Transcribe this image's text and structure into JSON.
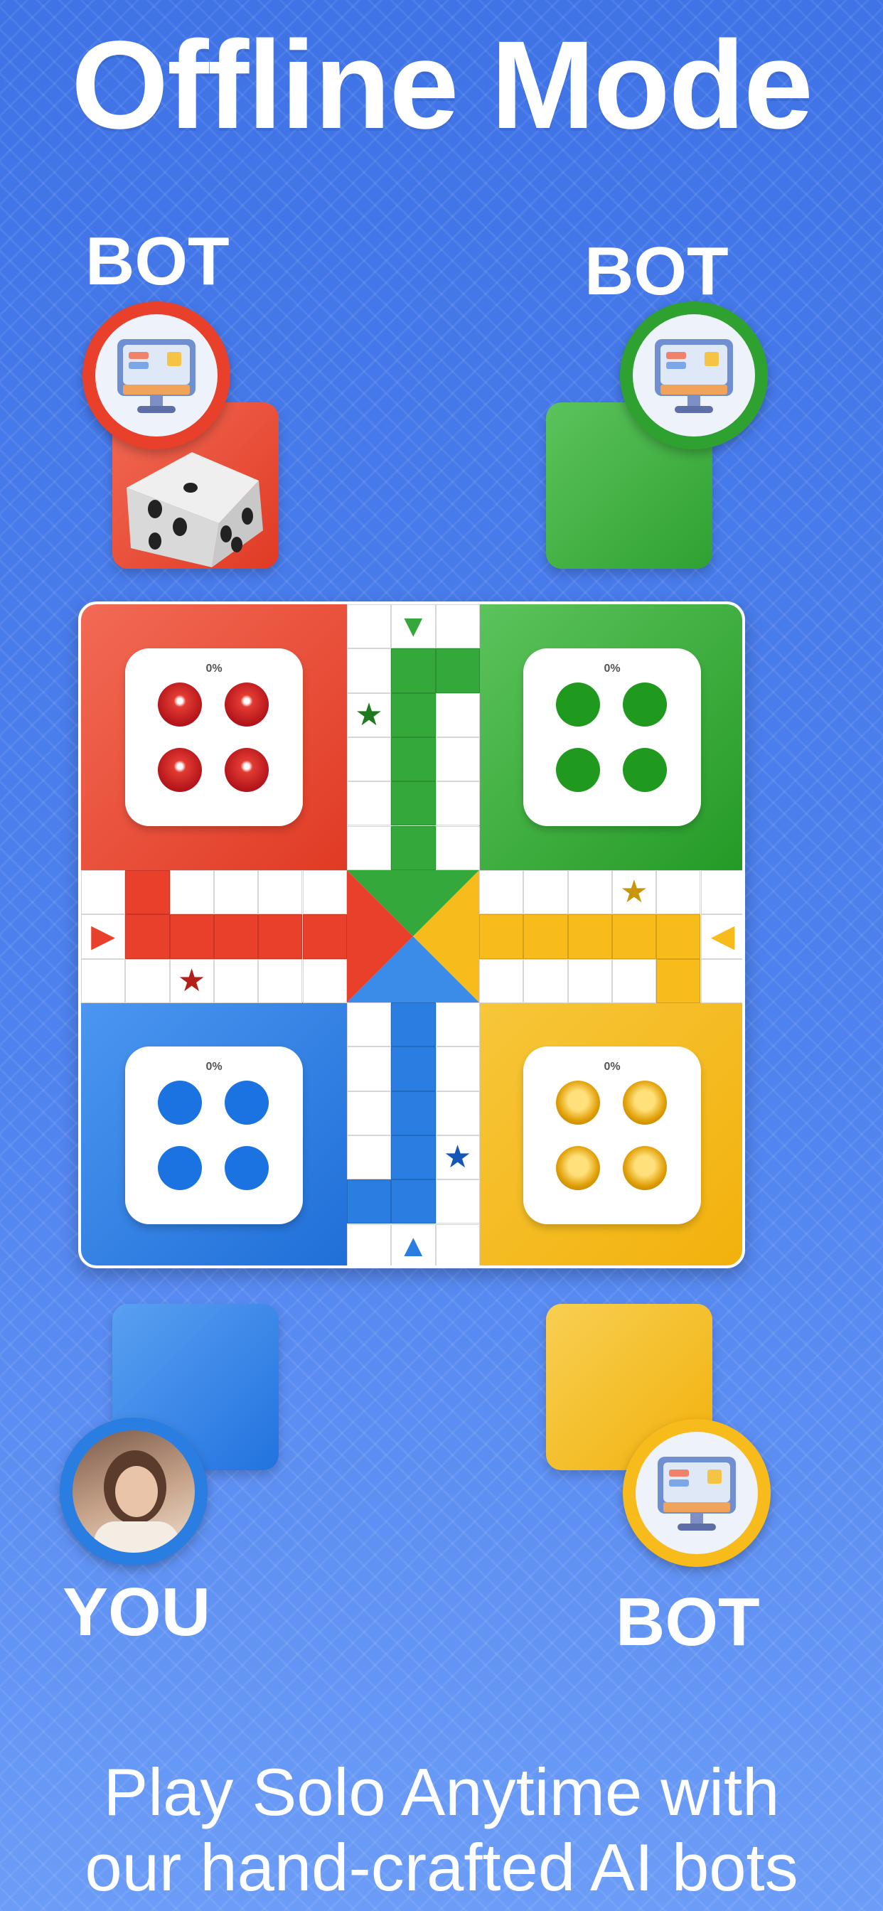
{
  "header": {
    "title": "Offline Mode"
  },
  "players": {
    "top_left": {
      "label": "BOT",
      "color": "#e8402b"
    },
    "top_right": {
      "label": "BOT",
      "color": "#2fa131"
    },
    "bottom_left": {
      "label": "YOU",
      "color": "#2a7de1"
    },
    "bottom_right": {
      "label": "BOT",
      "color": "#f7bb1c"
    }
  },
  "board": {
    "homes": {
      "red": {
        "progress": "0%",
        "color": "#e8402b"
      },
      "green": {
        "progress": "0%",
        "color": "#2fa131"
      },
      "blue": {
        "progress": "0%",
        "color": "#2a7de1"
      },
      "yellow": {
        "progress": "0%",
        "color": "#f7bb1c"
      }
    }
  },
  "icons": {
    "bot_avatar": "computer-monitor-icon",
    "dice": "dice-icon",
    "star": "safe-star-icon",
    "arrow": "start-arrow-icon"
  },
  "footer": {
    "line1": "Play Solo Anytime with",
    "line2": "our hand-crafted AI bots"
  }
}
